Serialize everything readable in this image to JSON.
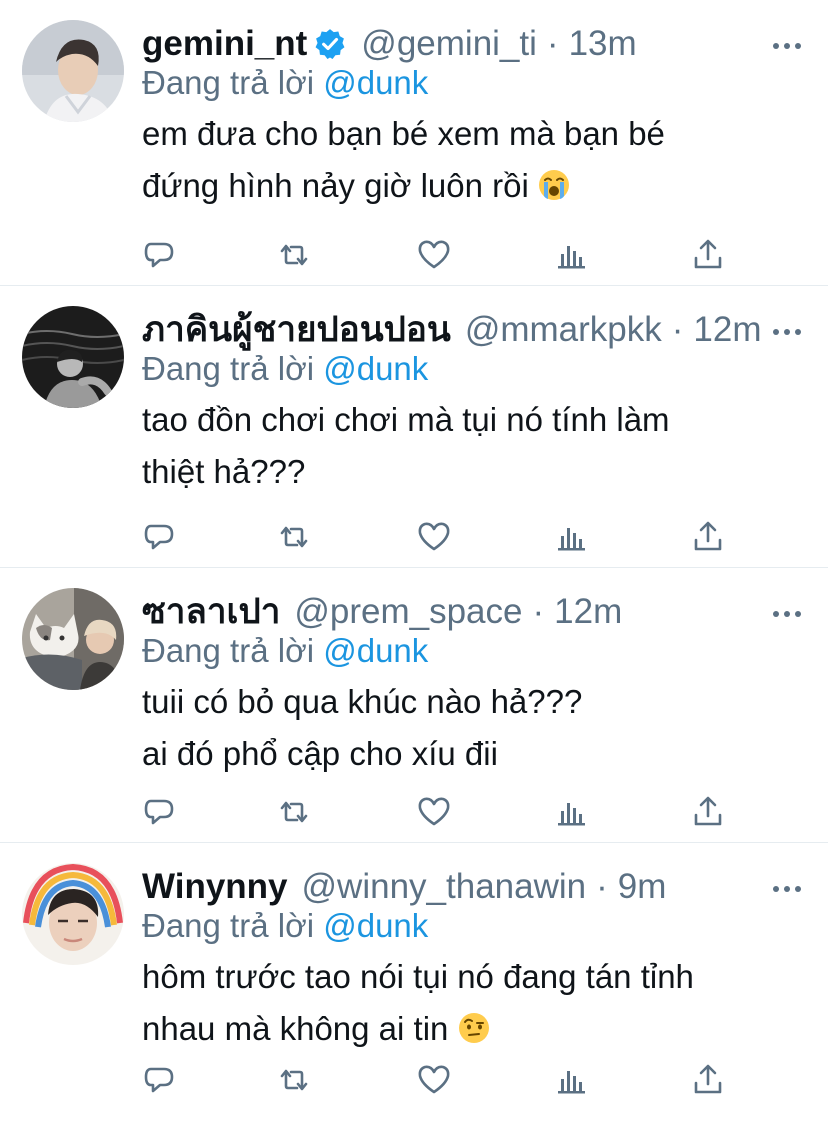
{
  "replying_prefix": "Đang trả lời",
  "colors": {
    "secondary_text": "#5b7083",
    "accent": "#1b95e0",
    "divider": "#e6ecf0",
    "verified": "#1da1f2"
  },
  "tweets": [
    {
      "name": "gemini_nt",
      "verified": true,
      "handle": "@gemini_ti",
      "separator": "·",
      "time": "13m",
      "replying_to": "@dunk",
      "lines": [
        "em đưa cho bạn bé xem mà bạn bé",
        "đứng hình nảy giờ luôn rồi"
      ],
      "trailing_emoji": "loudly-crying-face-emoji"
    },
    {
      "name": "ภาคินผู้ชายปอนปอน",
      "verified": false,
      "handle": "@mmarkpkk",
      "separator": "·",
      "time": "12m",
      "replying_to": "@dunk",
      "lines": [
        "tao đồn chơi chơi mà tụi nó tính làm",
        "thiệt hả???"
      ],
      "trailing_emoji": ""
    },
    {
      "name": "ซาลาเปา",
      "verified": false,
      "handle": "@prem_space",
      "separator": "·",
      "time": "12m",
      "replying_to": "@dunk",
      "lines": [
        "tuii có bỏ qua khúc nào hả???",
        "ai đó phổ cập cho xíu đii"
      ],
      "trailing_emoji": ""
    },
    {
      "name": "Winynny",
      "verified": false,
      "handle": "@winny_thanawin",
      "separator": "·",
      "time": "9m",
      "replying_to": "@dunk",
      "lines": [
        "hôm trước tao nói tụi nó đang tán tỉnh",
        "nhau mà không ai tin"
      ],
      "trailing_emoji": "face-with-raised-eyebrow-emoji"
    }
  ],
  "action_icons": [
    "reply-icon",
    "retweet-icon",
    "like-icon",
    "analytics-icon",
    "share-icon"
  ]
}
